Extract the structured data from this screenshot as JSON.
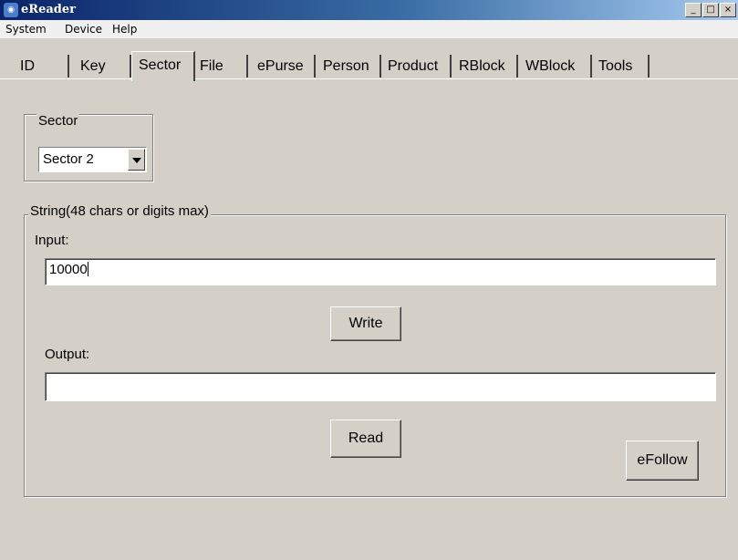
{
  "window": {
    "title": "eReader",
    "min": "_",
    "max": "□",
    "close": "×"
  },
  "menu": [
    "System",
    "Device",
    "Help"
  ],
  "tabs": [
    "ID",
    "Key",
    "Sector",
    "File",
    "ePurse",
    "Person",
    "Product",
    "RBlock",
    "WBlock",
    "Tools"
  ],
  "active_tab": "Sector",
  "sector_group": {
    "legend": "Sector",
    "selected": "Sector 2"
  },
  "string_group": {
    "legend": "String(48 chars or digits max)",
    "input_label": "Input:",
    "input_value": "10000",
    "write_button": "Write",
    "output_label": "Output:",
    "output_value": "",
    "read_button": "Read",
    "efollow_button": "eFollow"
  }
}
